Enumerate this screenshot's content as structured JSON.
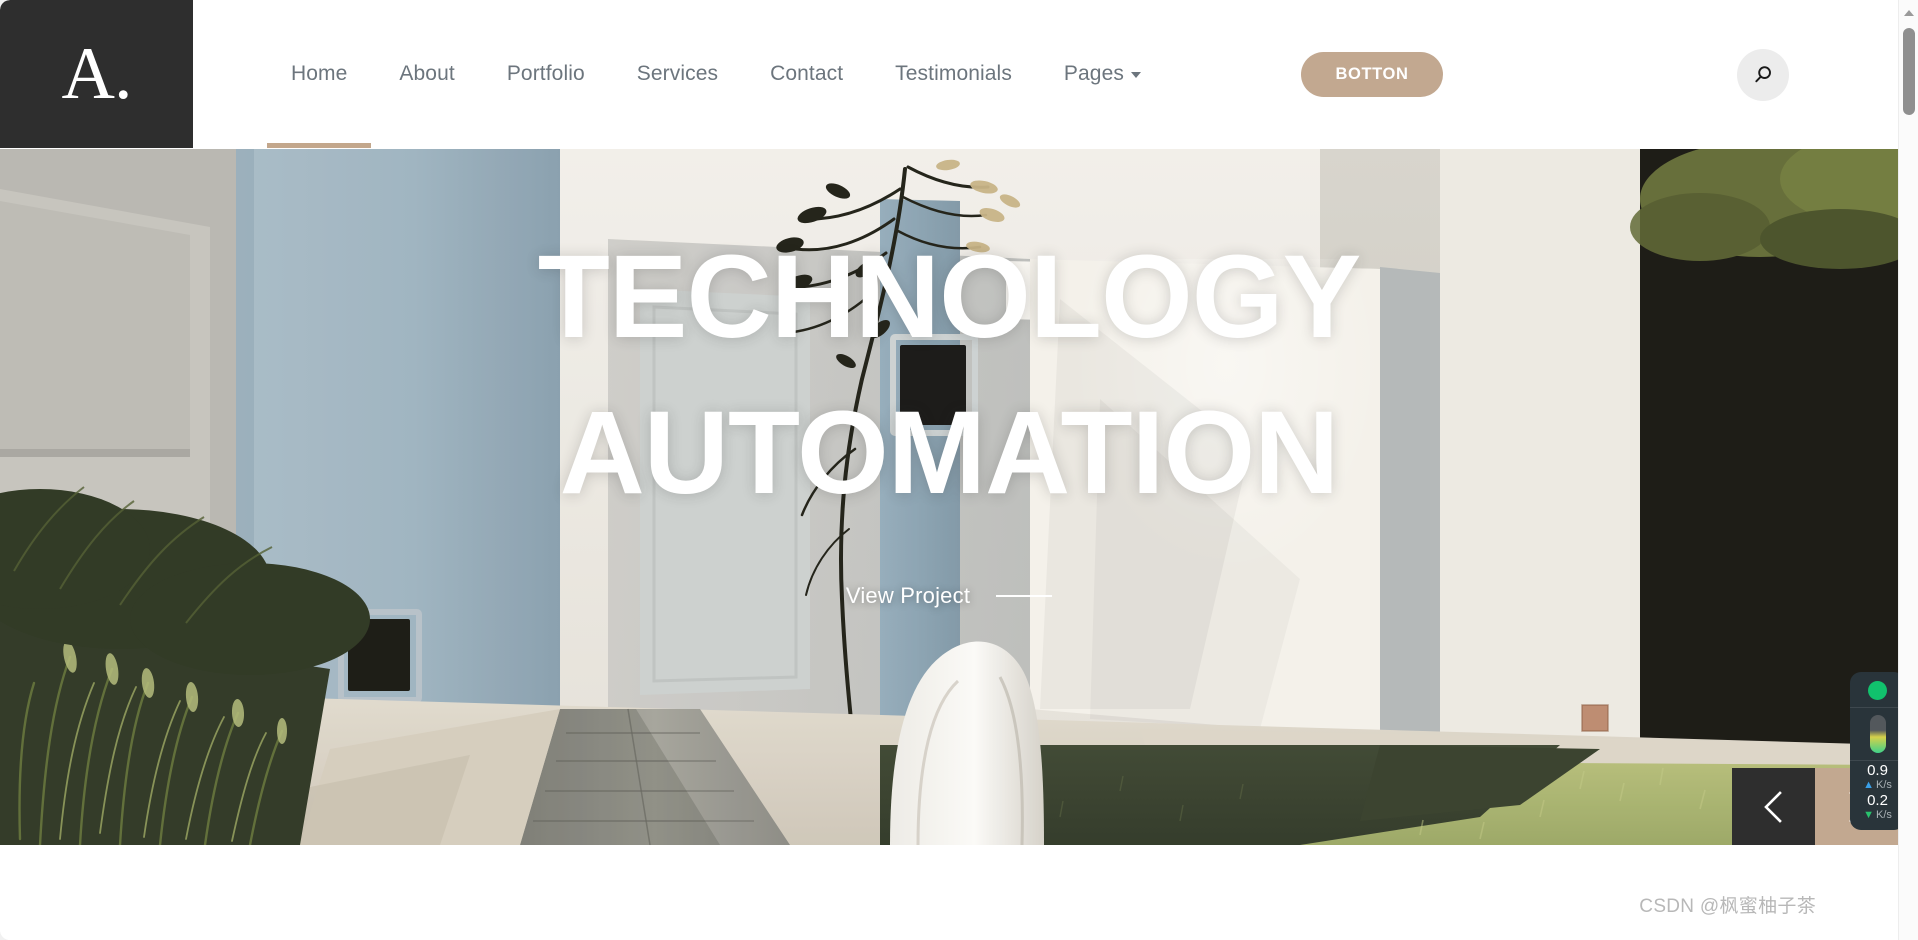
{
  "site": {
    "logo_text": "A.",
    "logo_bg": "#2e2e2e"
  },
  "header": {
    "nav_items": [
      {
        "label": "Home",
        "active": true,
        "has_dropdown": false
      },
      {
        "label": "About",
        "active": false,
        "has_dropdown": false
      },
      {
        "label": "Portfolio",
        "active": false,
        "has_dropdown": false
      },
      {
        "label": "Services",
        "active": false,
        "has_dropdown": false
      },
      {
        "label": "Contact",
        "active": false,
        "has_dropdown": false
      },
      {
        "label": "Testimonials",
        "active": false,
        "has_dropdown": false
      },
      {
        "label": "Pages",
        "active": false,
        "has_dropdown": true
      }
    ],
    "cta_label": "BOTTON",
    "cta_color": "#c2a890",
    "active_underline_color": "#c3a78c",
    "nav_text_color": "#6c757d",
    "search_icon": "search-icon"
  },
  "hero": {
    "title": "TECHNOLOGY\nAUTOMATION",
    "cta_label": "View Project",
    "prev_icon": "chevron-left-icon",
    "next_icon": "chevron-right-icon",
    "prev_bg": "#2e2e2e",
    "next_bg": "#c2a890"
  },
  "netspeed": {
    "status_icon": "status-dot-icon",
    "status_color": "#11c26d",
    "upload_value": "0.9",
    "upload_unit": "K/s",
    "upload_icon": "arrow-up-icon",
    "download_value": "0.2",
    "download_unit": "K/s",
    "download_icon": "arrow-down-icon"
  },
  "watermark": {
    "text": "CSDN @枫蜜柚子茶"
  },
  "scrollbar": {
    "up_icon": "scroll-up-arrow-icon"
  }
}
